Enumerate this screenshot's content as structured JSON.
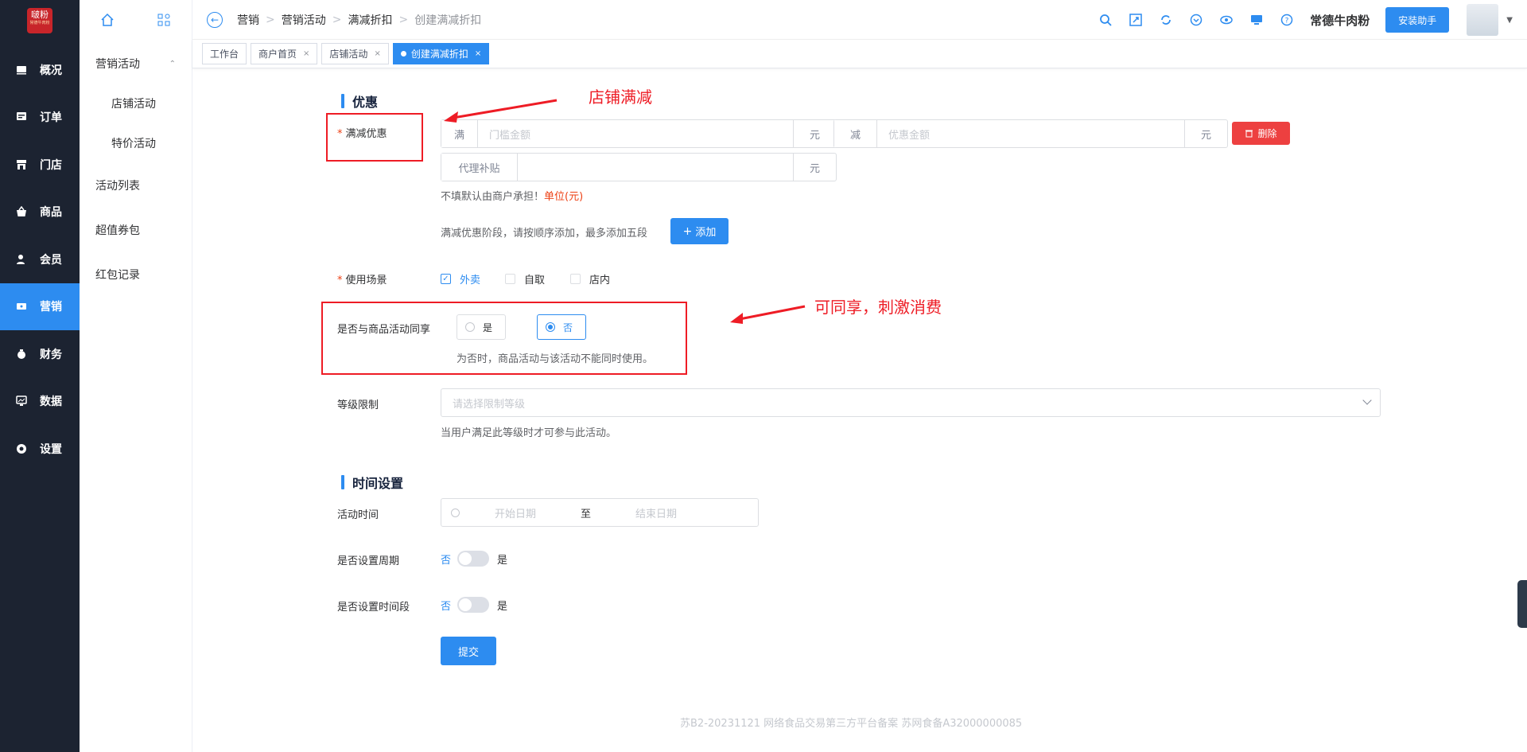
{
  "sidebar": {
    "logo": {
      "text": "啵粉",
      "sub": "常德牛肉粉"
    },
    "items": [
      {
        "label": "概况",
        "icon": "dashboard-icon"
      },
      {
        "label": "订单",
        "icon": "order-icon"
      },
      {
        "label": "门店",
        "icon": "store-icon"
      },
      {
        "label": "商品",
        "icon": "goods-icon"
      },
      {
        "label": "会员",
        "icon": "member-icon"
      },
      {
        "label": "营销",
        "icon": "marketing-icon",
        "active": true
      },
      {
        "label": "财务",
        "icon": "finance-icon"
      },
      {
        "label": "数据",
        "icon": "data-icon"
      },
      {
        "label": "设置",
        "icon": "settings-icon"
      }
    ]
  },
  "subnav": {
    "group": "营销活动",
    "children": [
      "店铺活动",
      "特价活动"
    ],
    "items": [
      "活动列表",
      "超值券包",
      "红包记录"
    ]
  },
  "header": {
    "breadcrumb": [
      "营销",
      "营销活动",
      "满减折扣",
      "创建满减折扣"
    ],
    "shop_name": "常德牛肉粉",
    "install_btn": "安装助手"
  },
  "tabs": [
    {
      "label": "工作台",
      "closable": false
    },
    {
      "label": "商户首页",
      "closable": true
    },
    {
      "label": "店铺活动",
      "closable": true
    },
    {
      "label": "创建满减折扣",
      "closable": true,
      "active": true
    }
  ],
  "tab_close": "×",
  "form": {
    "section1": "优惠",
    "discount_label": "满减优惠",
    "full_prefix": "满",
    "threshold_placeholder": "门槛金额",
    "unit": "元",
    "reduce_prefix": "减",
    "discount_placeholder": "优惠金额",
    "delete_btn": "删除",
    "agent_prefix": "代理补贴",
    "agent_hint": "不填默认由商户承担！",
    "agent_hint_unit": "单位(元)",
    "stage_hint": "满减优惠阶段，请按顺序添加，最多添加五段",
    "add_btn": "添加",
    "scene_label": "使用场景",
    "scenes": [
      {
        "label": "外卖",
        "checked": true
      },
      {
        "label": "自取",
        "checked": false
      },
      {
        "label": "店内",
        "checked": false
      }
    ],
    "share_label": "是否与商品活动同享",
    "share_yes": "是",
    "share_no": "否",
    "share_hint": "为否时，商品活动与该活动不能同时使用。",
    "level_label": "等级限制",
    "level_placeholder": "请选择限制等级",
    "level_hint": "当用户满足此等级时才可参与此活动。",
    "section2": "时间设置",
    "time_label": "活动时间",
    "start_placeholder": "开始日期",
    "range_sep": "至",
    "end_placeholder": "结束日期",
    "period_label": "是否设置周期",
    "timeslot_label": "是否设置时间段",
    "switch_off": "否",
    "switch_on": "是",
    "submit_btn": "提交"
  },
  "annotations": {
    "a1": "店铺满减",
    "a2": "可同享，刺激消费"
  },
  "footer": "苏B2-20231121  网络食品交易第三方平台备案 苏网食备A32000000085",
  "colors": {
    "primary": "#2d8cf0",
    "danger": "#ed4040",
    "sidebar_bg": "#1c2331",
    "annotation": "#ee1c25"
  }
}
